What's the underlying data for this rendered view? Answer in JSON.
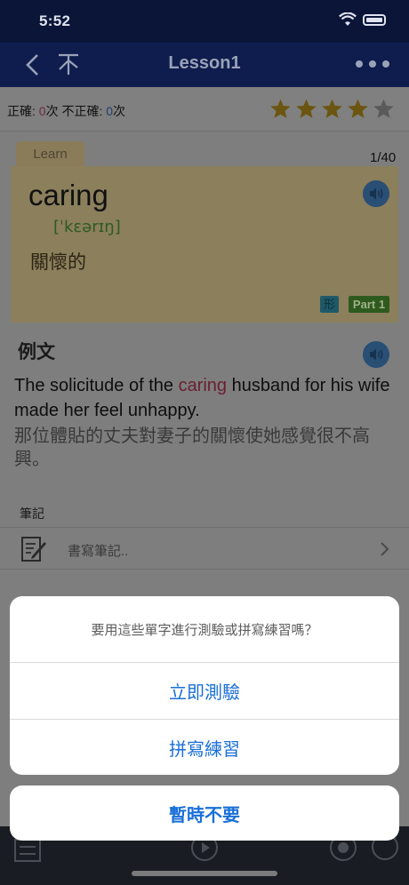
{
  "status_bar": {
    "time": "5:52"
  },
  "nav": {
    "title": "Lesson1"
  },
  "score": {
    "correct_label": "正確: ",
    "correct_value": "0",
    "times_unit": "次",
    "incorrect_label": " 不正確: ",
    "incorrect_value": "0",
    "times_unit2": "次",
    "stars_filled": 4,
    "stars_total": 5
  },
  "card": {
    "tab_label": "Learn",
    "counter": "1/40",
    "word": "caring",
    "phonetic": "[ˈkɛərɪŋ]",
    "meaning": "關懷的",
    "pos_badge": "形",
    "part_badge": "Part 1"
  },
  "example": {
    "heading": "例文",
    "en_before": "The solicitude of the ",
    "en_highlight": "caring",
    "en_after": " husband for his wife made her feel unhappy.",
    "zh": "那位體貼的丈夫對妻子的關懷使她感覺很不高興。"
  },
  "notes": {
    "label": "筆記",
    "placeholder": "書寫筆記.."
  },
  "action_sheet": {
    "prompt": "要用這些單字進行測驗或拼寫練習嗎？",
    "options": [
      "立即測驗",
      "拼寫練習"
    ],
    "cancel": "暫時不要"
  },
  "colors": {
    "accent": "#1a6fd8",
    "nav_bg": "#0e1d4d"
  }
}
